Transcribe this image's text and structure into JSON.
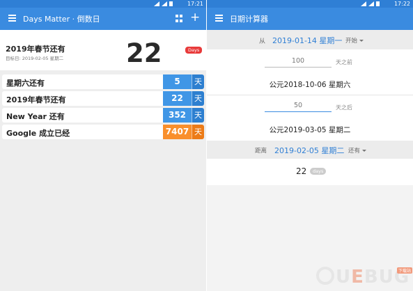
{
  "left": {
    "status": {
      "time": "17:21"
    },
    "appbar": {
      "title": "Days Matter · 倒数日"
    },
    "hero": {
      "title": "2019年春节还有",
      "subtitle": "目标日: 2019-02-05 星期二",
      "number": "22",
      "badge": "Days"
    },
    "rows": [
      {
        "label": "星期六还有",
        "value": "5",
        "unit": "天",
        "color": "#4096e6"
      },
      {
        "label": "2019年春节还有",
        "value": "22",
        "unit": "天",
        "color": "#4096e6"
      },
      {
        "label": "New Year 还有",
        "value": "352",
        "unit": "天",
        "color": "#4096e6"
      },
      {
        "label": "Google 成立已经",
        "value": "7407",
        "unit": "天",
        "color": "#f98f2c"
      }
    ]
  },
  "right": {
    "status": {
      "time": "17:22"
    },
    "appbar": {
      "title": "日期计算器"
    },
    "from": {
      "label": "从",
      "date": "2019-01-14 星期一",
      "select": "开始"
    },
    "before": {
      "value": "100",
      "hint": "天之前",
      "result": "公元2018-10-06 星期六"
    },
    "after": {
      "value": "50",
      "hint": "天之后",
      "result": "公元2019-03-05 星期二"
    },
    "distance": {
      "label": "距离",
      "date": "2019-02-05 星期二",
      "select": "还有"
    },
    "result": {
      "number": "22",
      "badge": "days"
    }
  },
  "watermark": {
    "text_a": "U",
    "text_b": "E",
    "text_c": "BUG",
    "tag": "下载站"
  },
  "colors": {
    "primary": "#3a8be0",
    "status": "#2f7fd5",
    "accent_orange": "#f98f2c",
    "badge_red": "#e83a3a"
  }
}
